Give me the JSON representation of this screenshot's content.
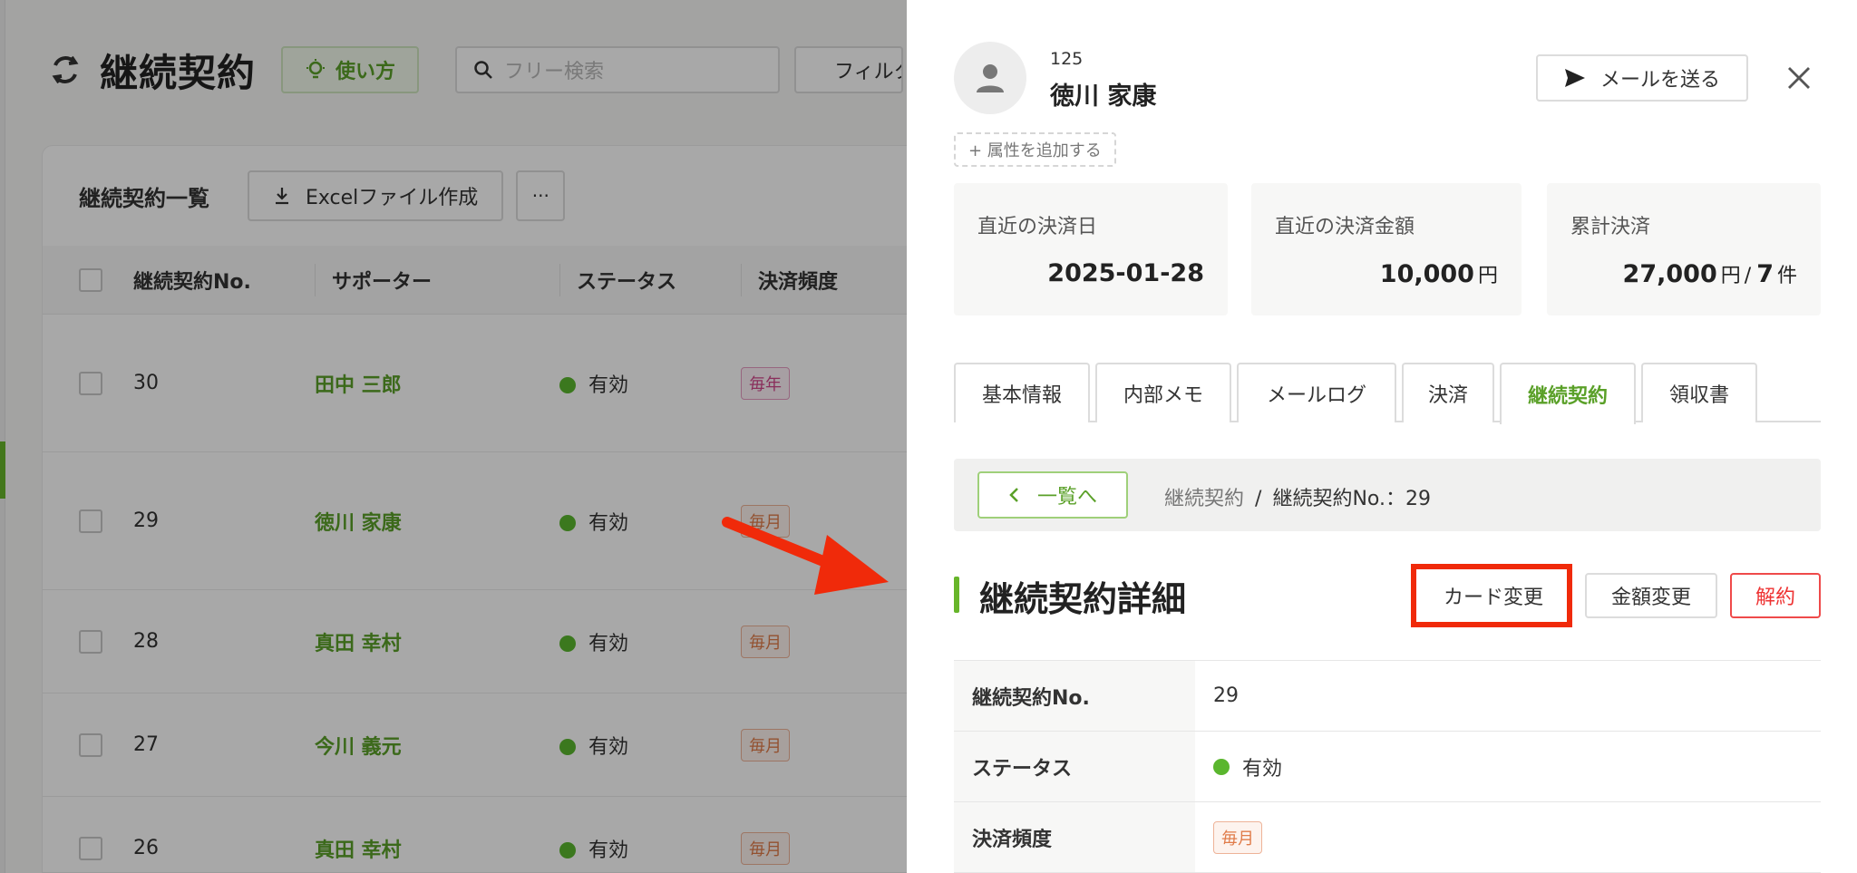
{
  "app": {
    "page_title": "継続契約",
    "howto_label": "使い方",
    "search_placeholder": "フリー検索",
    "filter_label": "フィルター"
  },
  "list": {
    "title": "継続契約一覧",
    "excel_label": "Excelファイル作成",
    "more_label": "···",
    "columns": [
      "継続契約No.",
      "サポーター",
      "ステータス",
      "決済頻度"
    ],
    "rows": [
      {
        "no": "30",
        "supporter": "田中 三郎",
        "status": "有効",
        "frequency": "毎年"
      },
      {
        "no": "29",
        "supporter": "徳川 家康",
        "status": "有効",
        "frequency": "毎月"
      },
      {
        "no": "28",
        "supporter": "真田 幸村",
        "status": "有効",
        "frequency": "毎月"
      },
      {
        "no": "27",
        "supporter": "今川 義元",
        "status": "有効",
        "frequency": "毎月"
      },
      {
        "no": "26",
        "supporter": "真田 幸村",
        "status": "有効",
        "frequency": "毎月"
      }
    ]
  },
  "drawer": {
    "supporter_id": "125",
    "supporter_name": "徳川 家康",
    "mail_label": "メールを送る",
    "add_attr_label": "+ 属性を追加する",
    "stats": {
      "last_date_label": "直近の決済日",
      "last_date_value": "2025-01-28",
      "last_amount_label": "直近の決済金額",
      "last_amount_value": "10,000",
      "total_label": "累計決済",
      "total_value": "27,000",
      "total_count": "7",
      "yen": "円",
      "slash": "/",
      "count_unit": "件"
    },
    "tabs": [
      "基本情報",
      "内部メモ",
      "メールログ",
      "決済",
      "継続契約",
      "領収書"
    ],
    "active_tab": "継続契約",
    "back_label": "一覧へ",
    "breadcrumb_link": "継続契約",
    "breadcrumb_sep": "/",
    "breadcrumb_current": "継続契約No.：29",
    "section_title": "継続契約詳細",
    "card_change_label": "カード変更",
    "amount_change_label": "金額変更",
    "cancel_label": "解約",
    "detail": {
      "no_label": "継続契約No.",
      "no_value": "29",
      "status_label": "ステータス",
      "status_value": "有効",
      "frequency_label": "決済頻度",
      "frequency_value": "毎月"
    }
  },
  "colors": {
    "brand_green": "#5aa028",
    "status_green": "#5ab62e",
    "annotation_red": "#f02a0a"
  }
}
